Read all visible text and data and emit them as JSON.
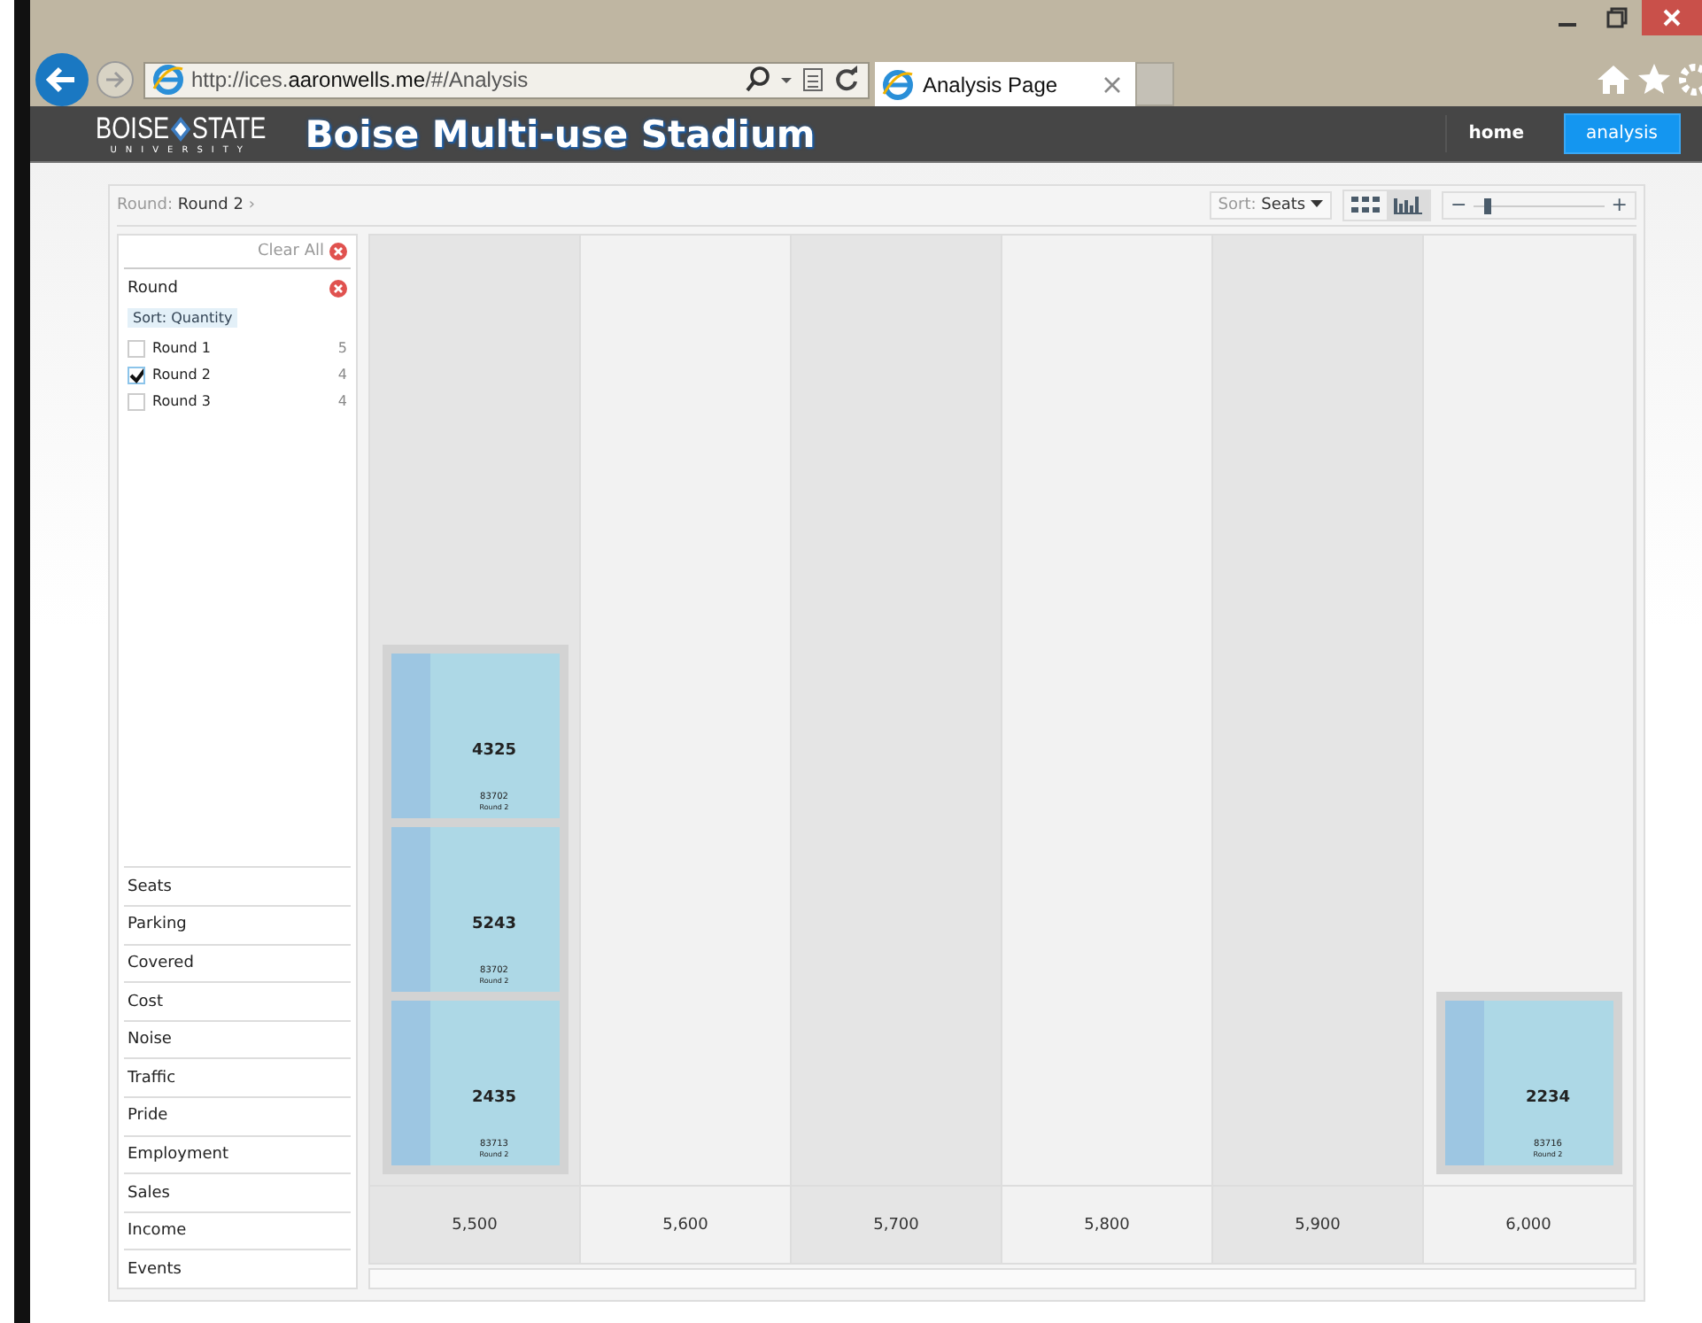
{
  "browser": {
    "url_prefix": "http://ices.",
    "url_domain": "aaronwells.me",
    "url_path": "/#/Analysis",
    "tab_title": "Analysis Page"
  },
  "app": {
    "title": "Boise Multi-use Stadium",
    "logo_left": "BOISE",
    "logo_right": "STATE",
    "logo_sub": "UNIVERSITY",
    "nav": [
      {
        "label": "home",
        "selected": false
      },
      {
        "label": "analysis",
        "selected": true
      }
    ]
  },
  "breadcrumb": {
    "label": "Round:",
    "value": "Round 2",
    "arrow": "›"
  },
  "toolbar": {
    "sort_label": "Sort:",
    "sort_value": "Seats",
    "views": [
      {
        "kind": "grid",
        "selected": false
      },
      {
        "kind": "bars",
        "selected": true
      }
    ],
    "zoom": {
      "minus": "−",
      "plus": "+",
      "level": 0.08
    }
  },
  "sidebar": {
    "clear_all": "Clear All",
    "filter": {
      "title": "Round",
      "sort": "Sort: Quantity",
      "options": [
        {
          "label": "Round 1",
          "count": "5",
          "checked": false
        },
        {
          "label": "Round 2",
          "count": "4",
          "checked": true
        },
        {
          "label": "Round 3",
          "count": "4",
          "checked": false
        }
      ]
    },
    "facets": [
      "Seats",
      "Parking",
      "Covered",
      "Cost",
      "Noise",
      "Traffic",
      "Pride",
      "Employment",
      "Sales",
      "Income",
      "Events"
    ]
  },
  "columns": [
    {
      "label": "5,500",
      "cards": [
        {
          "value": "4325",
          "zip": "83702",
          "round": "Round 2"
        },
        {
          "value": "5243",
          "zip": "83702",
          "round": "Round 2"
        },
        {
          "value": "2435",
          "zip": "83713",
          "round": "Round 2"
        }
      ]
    },
    {
      "label": "5,600"
    },
    {
      "label": "5,700"
    },
    {
      "label": "5,800"
    },
    {
      "label": "5,900"
    },
    {
      "label": "6,000",
      "cards": [
        {
          "value": "2234",
          "zip": "83716",
          "round": "Round 2"
        }
      ]
    }
  ]
}
